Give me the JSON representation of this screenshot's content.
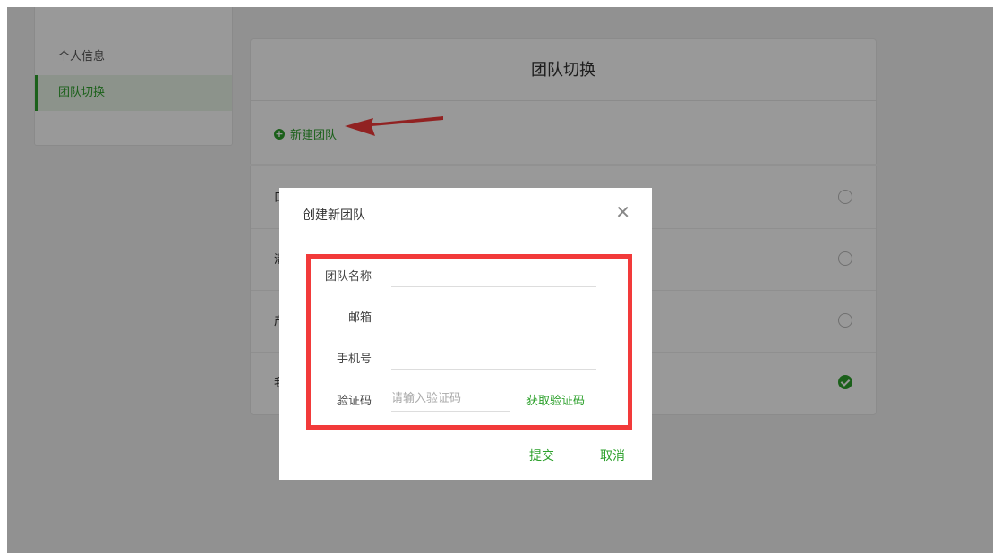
{
  "sidebar": {
    "items": [
      {
        "label": "个人信息"
      },
      {
        "label": "团队切换"
      }
    ]
  },
  "panel": {
    "title": "团队切换",
    "new_team_label": "新建团队",
    "teams": [
      {
        "name": "口",
        "selected": false
      },
      {
        "name": "清",
        "selected": false
      },
      {
        "name": "产",
        "selected": false
      },
      {
        "name": "我",
        "selected": true
      }
    ]
  },
  "dialog": {
    "title": "创建新团队",
    "close_icon": "close-icon",
    "fields": {
      "team_name": {
        "label": "团队名称",
        "value": "",
        "placeholder": ""
      },
      "email": {
        "label": "邮箱",
        "value": "",
        "placeholder": ""
      },
      "phone": {
        "label": "手机号",
        "value": "",
        "placeholder": ""
      },
      "code": {
        "label": "验证码",
        "value": "",
        "placeholder": "请输入验证码"
      }
    },
    "get_code_label": "获取验证码",
    "submit_label": "提交",
    "cancel_label": "取消"
  },
  "colors": {
    "accent": "#2da12c",
    "annotation": "#f23a3a"
  }
}
